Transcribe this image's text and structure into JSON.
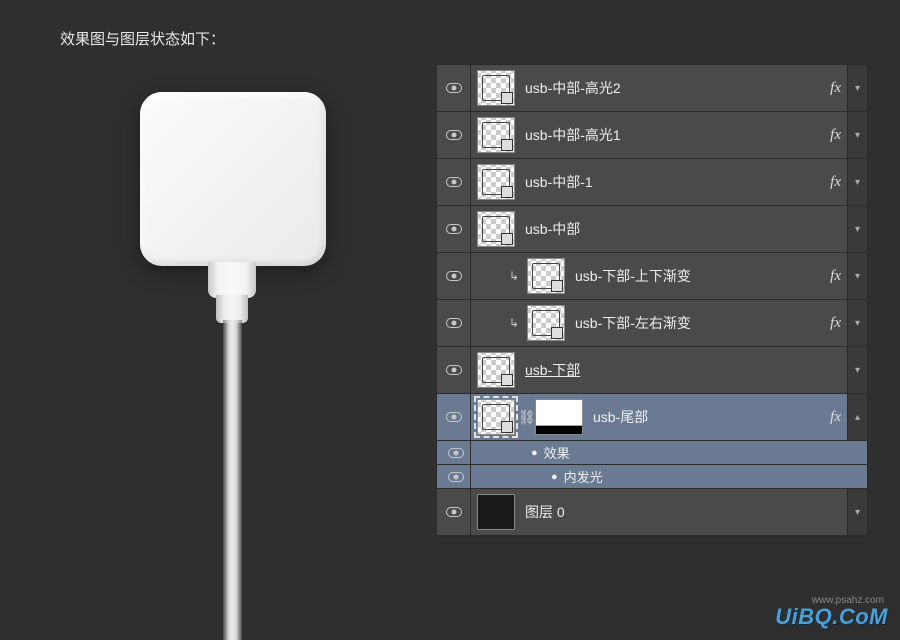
{
  "caption": "效果图与图层状态如下：",
  "layers": [
    {
      "name": "usb-中部-高光2",
      "fx": true,
      "clip": false,
      "underline": false
    },
    {
      "name": "usb-中部-高光1",
      "fx": true,
      "clip": false,
      "underline": false
    },
    {
      "name": "usb-中部-1",
      "fx": true,
      "clip": false,
      "underline": false
    },
    {
      "name": "usb-中部",
      "fx": false,
      "clip": false,
      "underline": false
    },
    {
      "name": "usb-下部-上下渐变",
      "fx": true,
      "clip": true,
      "underline": false
    },
    {
      "name": "usb-下部-左右渐变",
      "fx": true,
      "clip": true,
      "underline": false
    },
    {
      "name": "usb-下部",
      "fx": false,
      "clip": false,
      "underline": true
    },
    {
      "name": "usb-尾部",
      "fx": true,
      "clip": false,
      "underline": false,
      "selected": true,
      "hasMask": true
    }
  ],
  "effects": {
    "label": "效果",
    "items": [
      "内发光"
    ]
  },
  "baseLayer": {
    "name": "图层 0"
  },
  "watermark": "UiBQ.CoM",
  "watermark_sub": "www.psahz.com"
}
